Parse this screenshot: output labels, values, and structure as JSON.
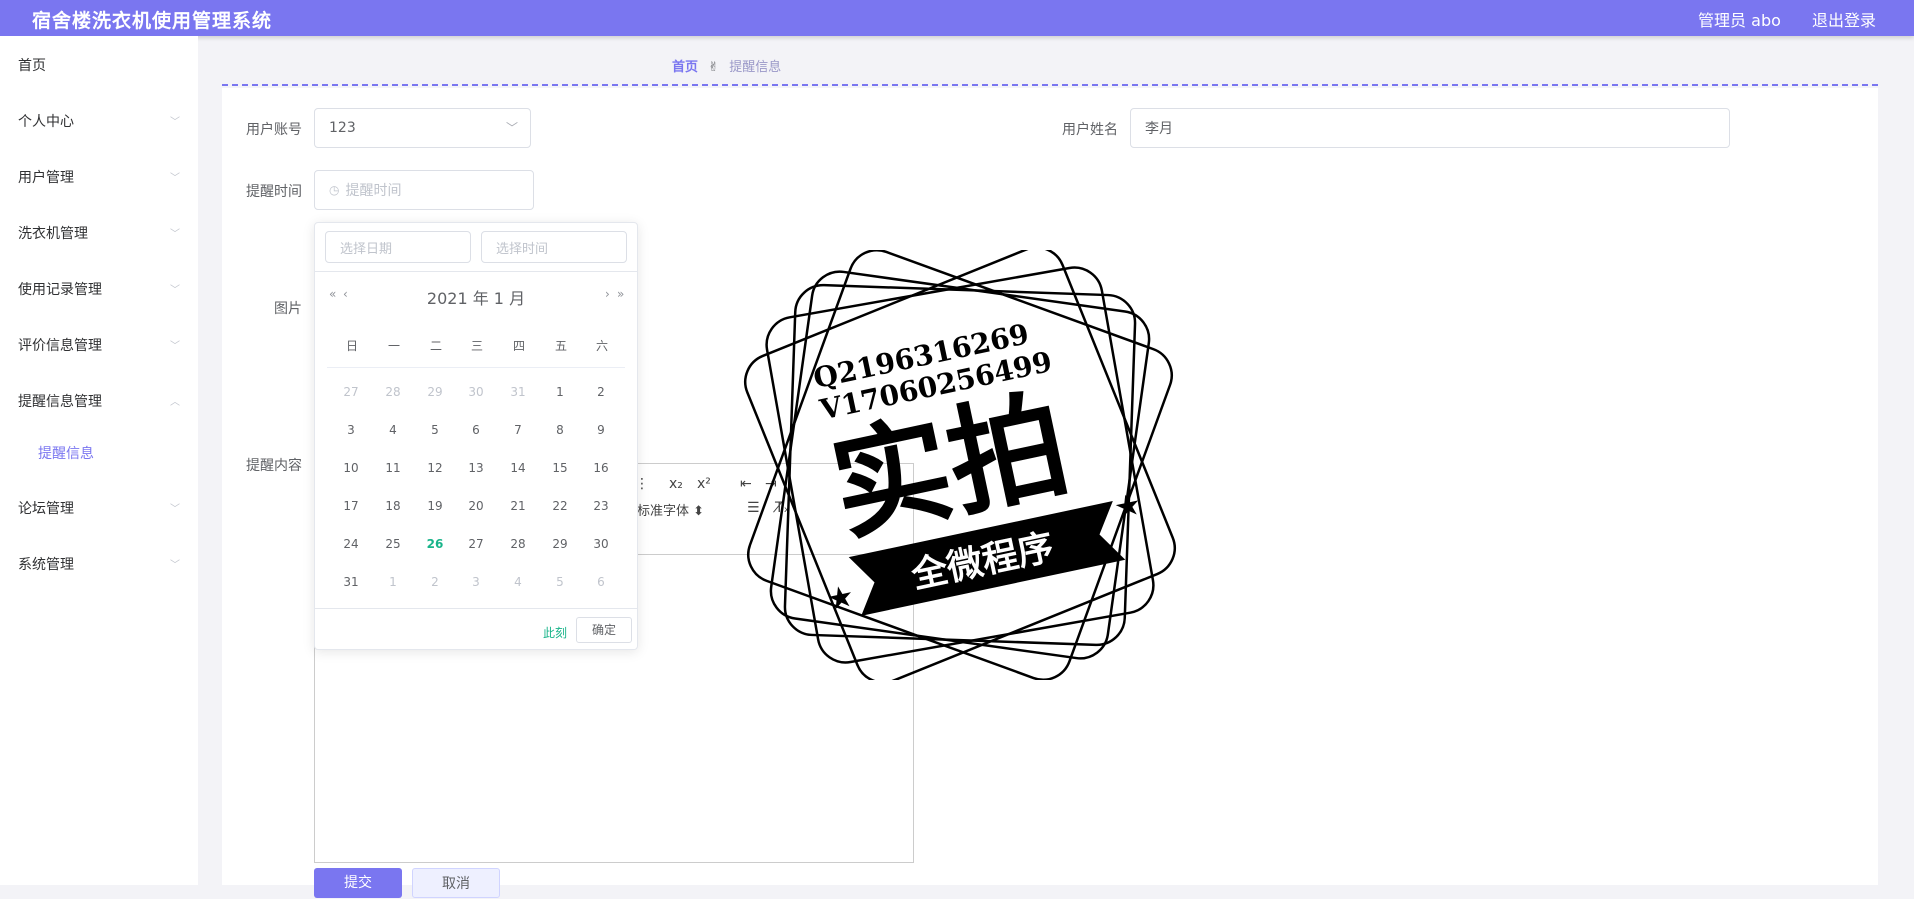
{
  "header": {
    "title": "宿舍楼洗衣机使用管理系统",
    "admin": "管理员 abo",
    "logout": "退出登录"
  },
  "sidebar": {
    "items": [
      {
        "label": "首页"
      },
      {
        "label": "个人中心"
      },
      {
        "label": "用户管理"
      },
      {
        "label": "洗衣机管理"
      },
      {
        "label": "使用记录管理"
      },
      {
        "label": "评价信息管理"
      },
      {
        "label": "提醒信息管理"
      },
      {
        "label": "论坛管理"
      },
      {
        "label": "系统管理"
      }
    ],
    "sub_item": "提醒信息"
  },
  "breadcrumb": {
    "home": "首页",
    "icon": "✌",
    "current": "提醒信息"
  },
  "form": {
    "account_label": "用户账号",
    "account_value": "123",
    "name_label": "用户姓名",
    "name_value": "李月",
    "time_label": "提醒时间",
    "time_placeholder": "提醒时间",
    "image_label": "图片",
    "content_label": "提醒内容",
    "font_select": "标准字体",
    "submit": "提交",
    "cancel": "取消"
  },
  "picker": {
    "date_placeholder": "选择日期",
    "time_placeholder": "选择时间",
    "header": "2021 年  1 月",
    "weekdays": [
      "日",
      "一",
      "二",
      "三",
      "四",
      "五",
      "六"
    ],
    "weeks": [
      [
        "27",
        "28",
        "29",
        "30",
        "31",
        "1",
        "2"
      ],
      [
        "3",
        "4",
        "5",
        "6",
        "7",
        "8",
        "9"
      ],
      [
        "10",
        "11",
        "12",
        "13",
        "14",
        "15",
        "16"
      ],
      [
        "17",
        "18",
        "19",
        "20",
        "21",
        "22",
        "23"
      ],
      [
        "24",
        "25",
        "26",
        "27",
        "28",
        "29",
        "30"
      ],
      [
        "31",
        "1",
        "2",
        "3",
        "4",
        "5",
        "6"
      ]
    ],
    "now": "此刻",
    "ok": "确定"
  },
  "stamp": {
    "line1": "Q2196316269",
    "line2": "V17060256499",
    "big": "实拍",
    "banner": "全微程序"
  },
  "colors": {
    "accent": "#7a76f0",
    "today": "#19b48a"
  }
}
